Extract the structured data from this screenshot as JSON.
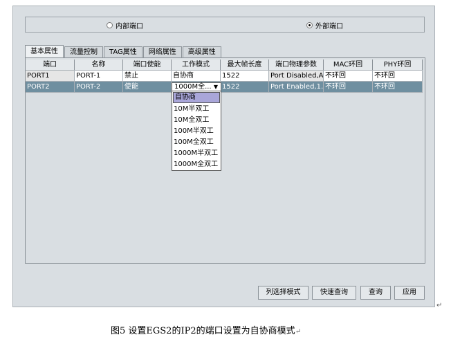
{
  "radio": {
    "internal_label": "内部端口",
    "external_label": "外部端口"
  },
  "tabs": [
    "基本属性",
    "流量控制",
    "TAG属性",
    "网络属性",
    "高级属性"
  ],
  "table": {
    "columns": [
      "端口",
      "名称",
      "端口使能",
      "工作模式",
      "最大帧长度",
      "端口物理参数",
      "MAC环回",
      "PHY环回"
    ],
    "rows": [
      [
        "PORT1",
        "PORT-1",
        "禁止",
        "自协商",
        "1522",
        "Port Disabled,A...",
        "不环回",
        "不环回"
      ],
      [
        "PORT2",
        "PORT-2",
        "使能",
        "1000M全...",
        "1522",
        "Port Enabled,1...",
        "不环回",
        "不环回"
      ]
    ]
  },
  "combo_arrow": "▼",
  "dropdown": {
    "options": [
      "自协商",
      "10M半双工",
      "10M全双工",
      "100M半双工",
      "100M全双工",
      "1000M半双工",
      "1000M全双工"
    ]
  },
  "buttons": {
    "column_mode": "列选择模式",
    "quick_query": "快速查询",
    "query": "查询",
    "apply": "应用"
  },
  "caption": "图5  设置EGS2的IP2的端口设置为自协商模式",
  "return_mark": "↵"
}
